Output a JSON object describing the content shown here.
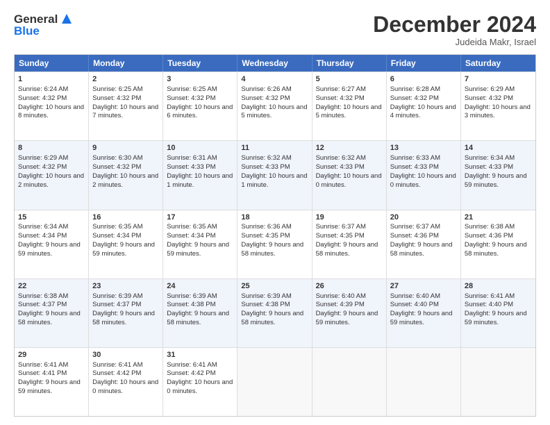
{
  "header": {
    "logo_line1": "General",
    "logo_line2": "Blue",
    "month_title": "December 2024",
    "location": "Judeida Makr, Israel"
  },
  "weekdays": [
    "Sunday",
    "Monday",
    "Tuesday",
    "Wednesday",
    "Thursday",
    "Friday",
    "Saturday"
  ],
  "weeks": [
    [
      {
        "day": "1",
        "sunrise": "6:24 AM",
        "sunset": "4:32 PM",
        "daylight": "10 hours and 8 minutes."
      },
      {
        "day": "2",
        "sunrise": "6:25 AM",
        "sunset": "4:32 PM",
        "daylight": "10 hours and 7 minutes."
      },
      {
        "day": "3",
        "sunrise": "6:25 AM",
        "sunset": "4:32 PM",
        "daylight": "10 hours and 6 minutes."
      },
      {
        "day": "4",
        "sunrise": "6:26 AM",
        "sunset": "4:32 PM",
        "daylight": "10 hours and 5 minutes."
      },
      {
        "day": "5",
        "sunrise": "6:27 AM",
        "sunset": "4:32 PM",
        "daylight": "10 hours and 5 minutes."
      },
      {
        "day": "6",
        "sunrise": "6:28 AM",
        "sunset": "4:32 PM",
        "daylight": "10 hours and 4 minutes."
      },
      {
        "day": "7",
        "sunrise": "6:29 AM",
        "sunset": "4:32 PM",
        "daylight": "10 hours and 3 minutes."
      }
    ],
    [
      {
        "day": "8",
        "sunrise": "6:29 AM",
        "sunset": "4:32 PM",
        "daylight": "10 hours and 2 minutes."
      },
      {
        "day": "9",
        "sunrise": "6:30 AM",
        "sunset": "4:32 PM",
        "daylight": "10 hours and 2 minutes."
      },
      {
        "day": "10",
        "sunrise": "6:31 AM",
        "sunset": "4:33 PM",
        "daylight": "10 hours and 1 minute."
      },
      {
        "day": "11",
        "sunrise": "6:32 AM",
        "sunset": "4:33 PM",
        "daylight": "10 hours and 1 minute."
      },
      {
        "day": "12",
        "sunrise": "6:32 AM",
        "sunset": "4:33 PM",
        "daylight": "10 hours and 0 minutes."
      },
      {
        "day": "13",
        "sunrise": "6:33 AM",
        "sunset": "4:33 PM",
        "daylight": "10 hours and 0 minutes."
      },
      {
        "day": "14",
        "sunrise": "6:34 AM",
        "sunset": "4:33 PM",
        "daylight": "9 hours and 59 minutes."
      }
    ],
    [
      {
        "day": "15",
        "sunrise": "6:34 AM",
        "sunset": "4:34 PM",
        "daylight": "9 hours and 59 minutes."
      },
      {
        "day": "16",
        "sunrise": "6:35 AM",
        "sunset": "4:34 PM",
        "daylight": "9 hours and 59 minutes."
      },
      {
        "day": "17",
        "sunrise": "6:35 AM",
        "sunset": "4:34 PM",
        "daylight": "9 hours and 59 minutes."
      },
      {
        "day": "18",
        "sunrise": "6:36 AM",
        "sunset": "4:35 PM",
        "daylight": "9 hours and 58 minutes."
      },
      {
        "day": "19",
        "sunrise": "6:37 AM",
        "sunset": "4:35 PM",
        "daylight": "9 hours and 58 minutes."
      },
      {
        "day": "20",
        "sunrise": "6:37 AM",
        "sunset": "4:36 PM",
        "daylight": "9 hours and 58 minutes."
      },
      {
        "day": "21",
        "sunrise": "6:38 AM",
        "sunset": "4:36 PM",
        "daylight": "9 hours and 58 minutes."
      }
    ],
    [
      {
        "day": "22",
        "sunrise": "6:38 AM",
        "sunset": "4:37 PM",
        "daylight": "9 hours and 58 minutes."
      },
      {
        "day": "23",
        "sunrise": "6:39 AM",
        "sunset": "4:37 PM",
        "daylight": "9 hours and 58 minutes."
      },
      {
        "day": "24",
        "sunrise": "6:39 AM",
        "sunset": "4:38 PM",
        "daylight": "9 hours and 58 minutes."
      },
      {
        "day": "25",
        "sunrise": "6:39 AM",
        "sunset": "4:38 PM",
        "daylight": "9 hours and 58 minutes."
      },
      {
        "day": "26",
        "sunrise": "6:40 AM",
        "sunset": "4:39 PM",
        "daylight": "9 hours and 59 minutes."
      },
      {
        "day": "27",
        "sunrise": "6:40 AM",
        "sunset": "4:40 PM",
        "daylight": "9 hours and 59 minutes."
      },
      {
        "day": "28",
        "sunrise": "6:41 AM",
        "sunset": "4:40 PM",
        "daylight": "9 hours and 59 minutes."
      }
    ],
    [
      {
        "day": "29",
        "sunrise": "6:41 AM",
        "sunset": "4:41 PM",
        "daylight": "9 hours and 59 minutes."
      },
      {
        "day": "30",
        "sunrise": "6:41 AM",
        "sunset": "4:42 PM",
        "daylight": "10 hours and 0 minutes."
      },
      {
        "day": "31",
        "sunrise": "6:41 AM",
        "sunset": "4:42 PM",
        "daylight": "10 hours and 0 minutes."
      },
      null,
      null,
      null,
      null
    ]
  ],
  "labels": {
    "sunrise": "Sunrise:",
    "sunset": "Sunset:",
    "daylight": "Daylight:"
  }
}
